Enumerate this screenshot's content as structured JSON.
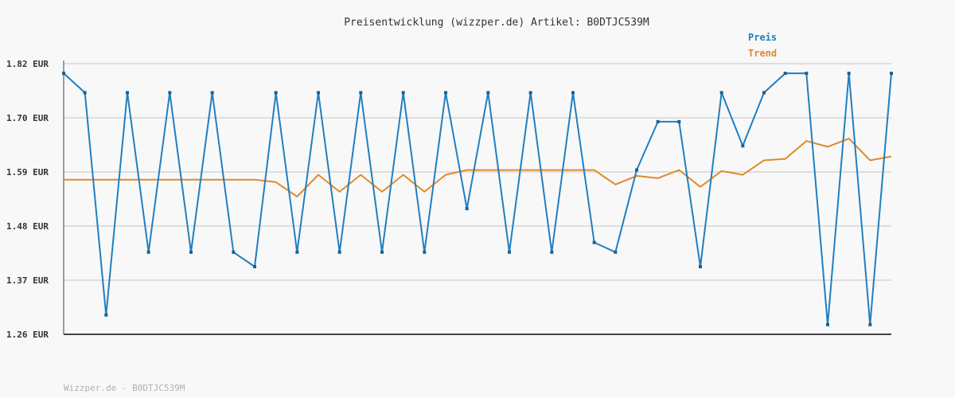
{
  "chart_data": {
    "type": "line",
    "title": "Preisentwicklung (wizzper.de) Artikel: B0DTJC539M",
    "ylabel": "",
    "xlabel": "",
    "yticks": [
      "1.82 EUR",
      "1.70 EUR",
      "1.59 EUR",
      "1.48 EUR",
      "1.37 EUR",
      "1.26 EUR"
    ],
    "ylim": [
      1.26,
      1.82
    ],
    "grid": true,
    "legend_position": "top-right",
    "series": [
      {
        "name": "Preis",
        "color": "#1f7fc1",
        "values": [
          1.8,
          1.76,
          1.3,
          1.76,
          1.43,
          1.76,
          1.43,
          1.76,
          1.43,
          1.4,
          1.76,
          1.43,
          1.76,
          1.43,
          1.76,
          1.43,
          1.76,
          1.43,
          1.76,
          1.52,
          1.76,
          1.43,
          1.76,
          1.43,
          1.76,
          1.45,
          1.43,
          1.6,
          1.7,
          1.7,
          1.4,
          1.76,
          1.65,
          1.76,
          1.8,
          1.8,
          1.28,
          1.8,
          1.28,
          1.8
        ]
      },
      {
        "name": "Trend",
        "color": "#e08a2a",
        "values": [
          1.58,
          1.58,
          1.58,
          1.58,
          1.58,
          1.58,
          1.58,
          1.58,
          1.58,
          1.58,
          1.575,
          1.545,
          1.59,
          1.555,
          1.59,
          1.555,
          1.59,
          1.555,
          1.59,
          1.6,
          1.6,
          1.6,
          1.6,
          1.6,
          1.6,
          1.6,
          1.57,
          1.588,
          1.583,
          1.6,
          1.565,
          1.598,
          1.59,
          1.62,
          1.623,
          1.66,
          1.648,
          1.665,
          1.62,
          1.628
        ]
      }
    ]
  },
  "footer": {
    "text": "Wizzper.de - B0DTJC539M"
  }
}
